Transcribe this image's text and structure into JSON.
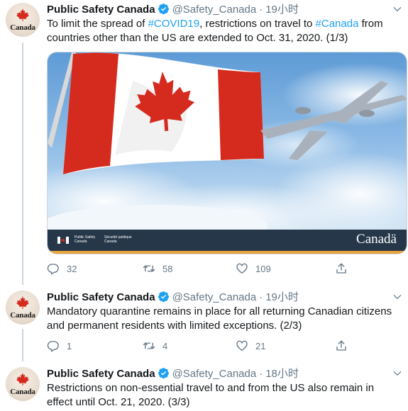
{
  "tweets": [
    {
      "name": "Public Safety Canada",
      "handle": "@Safety_Canada",
      "dot": "·",
      "time": "19小时",
      "avatar_label": "Canada",
      "text_parts": {
        "t1": "To limit the spread of ",
        "h1": "#COVID19",
        "t2": ", restrictions on travel to ",
        "h2": "#Canada",
        "t3": " from countries other than the US are extended to Oct. 31, 2020. (1/3)"
      },
      "media": {
        "banner_left_en": "Public Safety Canada",
        "banner_left_fr": "Sécurité publique Canada",
        "wordmark": "Canadä"
      },
      "counts": {
        "reply": "32",
        "retweet": "58",
        "like": "109"
      }
    },
    {
      "name": "Public Safety Canada",
      "handle": "@Safety_Canada",
      "dot": "·",
      "time": "19小时",
      "avatar_label": "Canada",
      "text": "Mandatory quarantine remains in place for all returning Canadian citizens and permanent residents with limited exceptions. (2/3)",
      "counts": {
        "reply": "1",
        "retweet": "4",
        "like": "21"
      }
    },
    {
      "name": "Public Safety Canada",
      "handle": "@Safety_Canada",
      "dot": "·",
      "time": "18小时",
      "avatar_label": "Canada",
      "text": "Restrictions on non-essential travel to and from the US also remain in effect until Oct. 21, 2020. (3/3)"
    }
  ],
  "colors": {
    "link": "#1da1f2",
    "verified": "#1da1f2",
    "muted": "#657786",
    "flag_red": "#d52b1e"
  },
  "icons": [
    "verified-badge-icon",
    "chevron-down-icon",
    "reply-icon",
    "retweet-icon",
    "like-icon",
    "share-icon",
    "maple-leaf-icon"
  ]
}
